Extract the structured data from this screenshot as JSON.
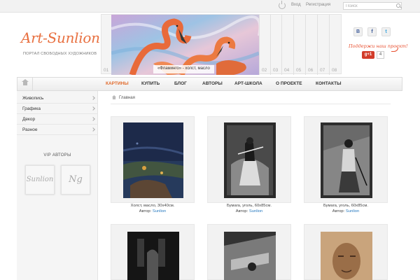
{
  "topbar": {
    "login_label": "Вход",
    "register_label": "Регистрация",
    "search_placeholder": "Поиск"
  },
  "header": {
    "logo_text": "Art-Sunlion",
    "logo_subtitle": "ПОРТАЛ СВОБОДНЫХ ХУДОЖНИКОВ",
    "banner_caption": "«Фламинго» - холст, масло",
    "slide_numbers": [
      "01",
      "02",
      "03",
      "04",
      "05",
      "06",
      "07",
      "08"
    ],
    "social": {
      "vk": "В",
      "facebook": "f",
      "twitter": "t"
    },
    "support_text": "Поддержи наш проект!",
    "gplus_label": "g+1",
    "gplus_count": "4"
  },
  "nav": {
    "items": [
      {
        "label": "КАРТИНЫ",
        "active": true
      },
      {
        "label": "КУПИТЬ"
      },
      {
        "label": "БЛОГ"
      },
      {
        "label": "АВТОРЫ"
      },
      {
        "label": "АРТ-ШКОЛА"
      },
      {
        "label": "О ПРОЕКТЕ"
      },
      {
        "label": "КОНТАКТЫ"
      }
    ]
  },
  "sidebar": {
    "items": [
      {
        "label": "Живопись"
      },
      {
        "label": "Графика"
      },
      {
        "label": "Декор"
      },
      {
        "label": "Разное"
      }
    ],
    "vip_title": "VIP АВТОРЫ",
    "vip_authors": [
      {
        "signature": "Sunlion"
      },
      {
        "signature": "Ng"
      }
    ]
  },
  "breadcrumb": {
    "home": "Главная"
  },
  "gallery": {
    "author_prefix": "Автор:",
    "items": [
      {
        "caption": "Холст, масло, 30x40см.",
        "author": "Sunlion"
      },
      {
        "caption": "Бумага, уголь, 60x85см.",
        "author": "Sunlion"
      },
      {
        "caption": "Бумага, уголь, 60x85см.",
        "author": "Sunlion"
      },
      {
        "caption": "",
        "author": ""
      },
      {
        "caption": "",
        "author": ""
      },
      {
        "caption": "",
        "author": ""
      }
    ]
  },
  "colors": {
    "accent": "#e06a2b",
    "link": "#2a7bc0",
    "gplus": "#d23c2a"
  }
}
